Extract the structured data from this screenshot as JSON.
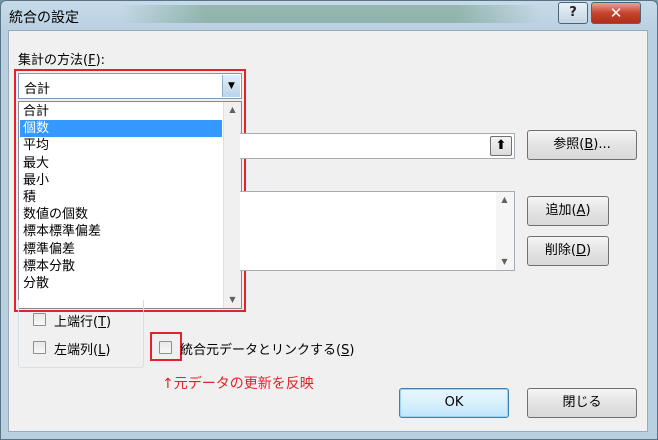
{
  "window": {
    "title": "統合の設定"
  },
  "titlebar": {
    "help_label": "?",
    "close_label": "✕"
  },
  "function": {
    "label_prefix": "集計の方法(",
    "label_key": "F",
    "label_suffix": "):",
    "selected": "合計",
    "options": [
      "合計",
      "個数",
      "平均",
      "最大",
      "最小",
      "積",
      "数値の個数",
      "標本標準偏差",
      "標準偏差",
      "標本分散",
      "分散"
    ],
    "highlighted_index": 1
  },
  "buttons": {
    "browse": {
      "text": "参照(",
      "key": "B",
      "suffix": ")..."
    },
    "add": {
      "text": "追加(",
      "key": "A",
      "suffix": ")"
    },
    "delete": {
      "text": "削除(",
      "key": "D",
      "suffix": ")"
    },
    "ok": "OK",
    "close": "閉じる"
  },
  "labels_group": {
    "top_row": {
      "text": "上端行(",
      "key": "T",
      "suffix": ")"
    },
    "left_col": {
      "text": "左端列(",
      "key": "L",
      "suffix": ")"
    }
  },
  "link_option": {
    "text": "統合元データとリンクする(",
    "key": "S",
    "suffix": ")"
  },
  "annotation": "↑元データの更新を反映",
  "icons": {
    "ref_button": "upload-arrow-icon",
    "combo_arrow": "triangle-down-icon"
  },
  "colors": {
    "highlight": "#3399ff",
    "annotation_red": "#e8202a"
  }
}
